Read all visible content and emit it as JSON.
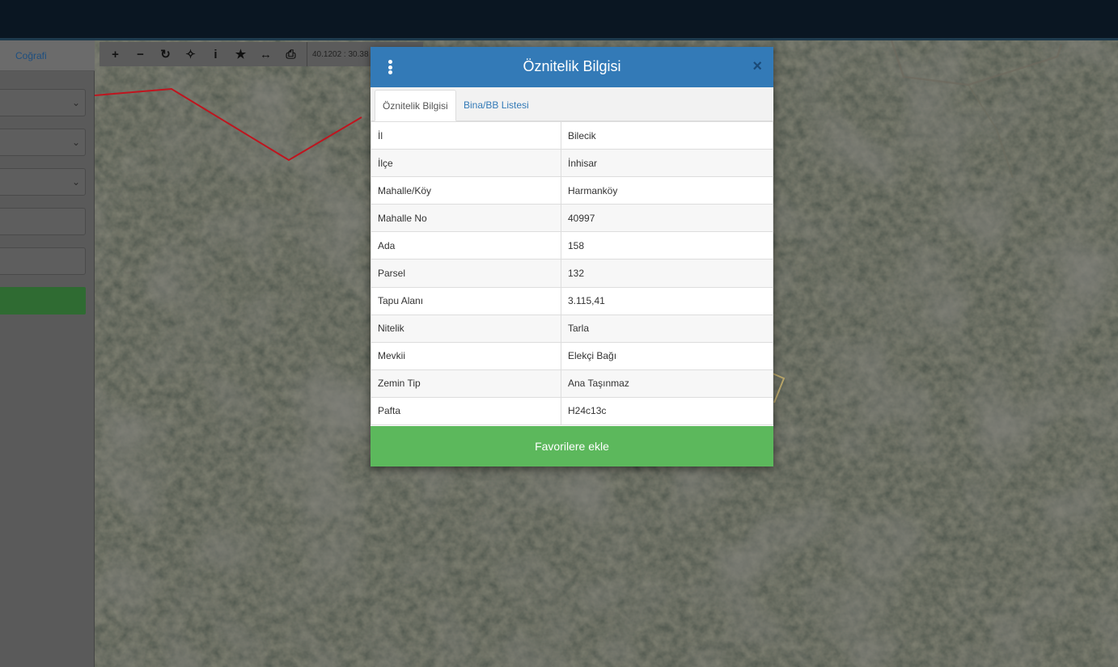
{
  "left_panel": {
    "tab_label": "Coğrafi"
  },
  "toolbar": {
    "coordinate_text": "40.1202 : 30.38"
  },
  "modal": {
    "title": "Öznitelik Bilgisi",
    "close_label": "×",
    "tabs": [
      {
        "label": "Öznitelik Bilgisi",
        "active": true
      },
      {
        "label": "Bina/BB Listesi",
        "active": false
      }
    ],
    "rows": [
      {
        "key": "İl",
        "value": "Bilecik"
      },
      {
        "key": "İlçe",
        "value": "İnhisar"
      },
      {
        "key": "Mahalle/Köy",
        "value": "Harmanköy"
      },
      {
        "key": "Mahalle No",
        "value": "40997"
      },
      {
        "key": "Ada",
        "value": "158"
      },
      {
        "key": "Parsel",
        "value": "132"
      },
      {
        "key": "Tapu Alanı",
        "value": "3.115,41"
      },
      {
        "key": "Nitelik",
        "value": "Tarla"
      },
      {
        "key": "Mevkii",
        "value": "Elekçi Bağı"
      },
      {
        "key": "Zemin Tip",
        "value": "Ana Taşınmaz"
      },
      {
        "key": "Pafta",
        "value": "H24c13c"
      }
    ],
    "favorite_button_label": "Favorilere ekle"
  },
  "colors": {
    "header_blue": "#337ab7",
    "favorite_green": "#5cb85c",
    "parcel_border_red": "#c0141e"
  }
}
